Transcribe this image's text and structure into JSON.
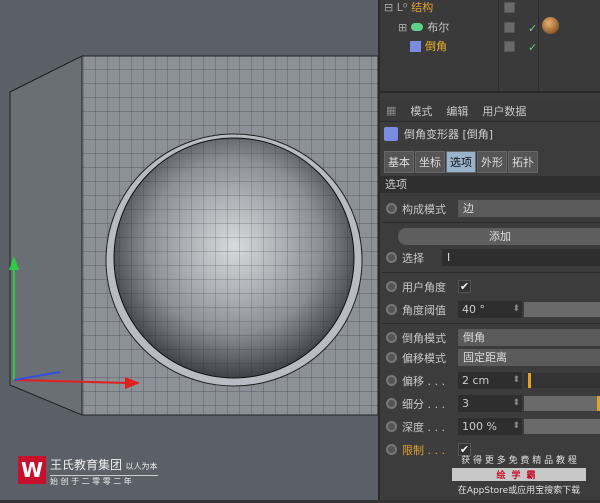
{
  "object_manager": {
    "items": [
      {
        "label": "结构",
        "color": "#e0a030"
      },
      {
        "label": "布尔",
        "color": "#c8c8c8"
      },
      {
        "label": "倒角",
        "color": "#f0b030"
      }
    ]
  },
  "attr": {
    "menu": [
      "模式",
      "编辑",
      "用户数据"
    ],
    "title": "倒角变形器 [倒角]",
    "tabs": [
      "基本",
      "坐标",
      "选项",
      "外形",
      "拓扑"
    ],
    "active_tab": "选项",
    "section": "选项",
    "build_mode": {
      "label": "构成模式",
      "value": "边"
    },
    "add_button": "添加",
    "selection": {
      "label": "选择",
      "value": "I"
    },
    "use_angle": {
      "label": "用户角度",
      "checked": true,
      "mark": "✔"
    },
    "angle_threshold": {
      "label": "角度阈值",
      "value": "40 °"
    },
    "bevel_mode": {
      "label": "倒角模式",
      "value": "倒角"
    },
    "offset_mode": {
      "label": "偏移模式",
      "value": "固定距离"
    },
    "offset": {
      "label": "偏移 . . .",
      "value": "2 cm",
      "slider_fraction": 0.05
    },
    "subdivision": {
      "label": "细分 . . .",
      "value": "3",
      "slider_fraction": 0.98
    },
    "depth": {
      "label": "深度 . . .",
      "value": "100 %"
    },
    "limit": {
      "label": "限制 . . .",
      "checked": true,
      "mark": "✔",
      "color": "#e0a030"
    }
  },
  "watermark": {
    "logo_company": "王氏教育集团",
    "logo_slogan": "以人为本",
    "logo_sub": "始 创 于 二 零 零 二 年",
    "promo_line1": "获 得 更 多 免 费 精 品 教 程",
    "promo_brand": "绘学霸",
    "promo_line2": "在AppStore或应用宝搜索下载"
  }
}
